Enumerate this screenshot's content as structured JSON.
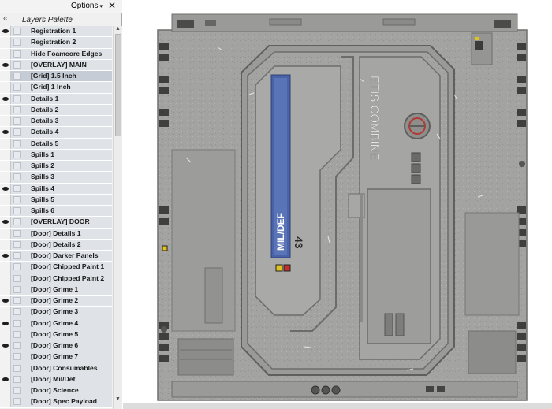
{
  "palette": {
    "options_label": "Options",
    "options_arrow": "▾",
    "close_glyph": "✕",
    "title": "Layers Palette",
    "chevron_glyph": "«",
    "layers": [
      {
        "name": "Registration 1",
        "visible": true
      },
      {
        "name": "Registration 2",
        "visible": false
      },
      {
        "name": "Hide Foamcore Edges",
        "visible": false
      },
      {
        "name": "[OVERLAY] MAIN",
        "visible": true
      },
      {
        "name": "[Grid] 1.5 Inch",
        "visible": false,
        "selected": true
      },
      {
        "name": "[Grid] 1 Inch",
        "visible": false
      },
      {
        "name": "Details 1",
        "visible": true
      },
      {
        "name": "Details 2",
        "visible": false
      },
      {
        "name": "Details 3",
        "visible": false
      },
      {
        "name": "Details 4",
        "visible": true
      },
      {
        "name": "Details 5",
        "visible": false
      },
      {
        "name": "Spills 1",
        "visible": false
      },
      {
        "name": "Spills 2",
        "visible": false
      },
      {
        "name": "Spills 3",
        "visible": false
      },
      {
        "name": "Spills 4",
        "visible": true
      },
      {
        "name": "Spills 5",
        "visible": false
      },
      {
        "name": "Spills 6",
        "visible": false
      },
      {
        "name": "[OVERLAY] DOOR",
        "visible": true
      },
      {
        "name": "[Door] Details 1",
        "visible": false
      },
      {
        "name": "[Door] Details 2",
        "visible": false
      },
      {
        "name": "[Door] Darker Panels",
        "visible": true
      },
      {
        "name": "[Door] Chipped Paint 1",
        "visible": false
      },
      {
        "name": "[Door] Chipped Paint 2",
        "visible": false
      },
      {
        "name": "[Door] Grime 1",
        "visible": false
      },
      {
        "name": "[Door] Grime 2",
        "visible": true
      },
      {
        "name": "[Door] Grime 3",
        "visible": false
      },
      {
        "name": "[Door] Grime 4",
        "visible": true
      },
      {
        "name": "[Door] Grime 5",
        "visible": false
      },
      {
        "name": "[Door] Grime 6",
        "visible": true
      },
      {
        "name": "[Door] Grime 7",
        "visible": false
      },
      {
        "name": "[Door] Consumables",
        "visible": false
      },
      {
        "name": "[Door] Mil/Def",
        "visible": true
      },
      {
        "name": "[Door] Science",
        "visible": false
      },
      {
        "name": "[Door] Spec Payload",
        "visible": false
      }
    ]
  },
  "artwork": {
    "stripe_label": "MIL/DEF",
    "stripe_number": "43",
    "brand_text": "ETIS COMBINE",
    "colors": {
      "metal": "#a3a3a1",
      "metal_dark": "#8d8d8b",
      "stripe_blue": "#4a63a8",
      "hazard_yellow": "#e2c21c",
      "hazard_red": "#c0322a"
    }
  }
}
